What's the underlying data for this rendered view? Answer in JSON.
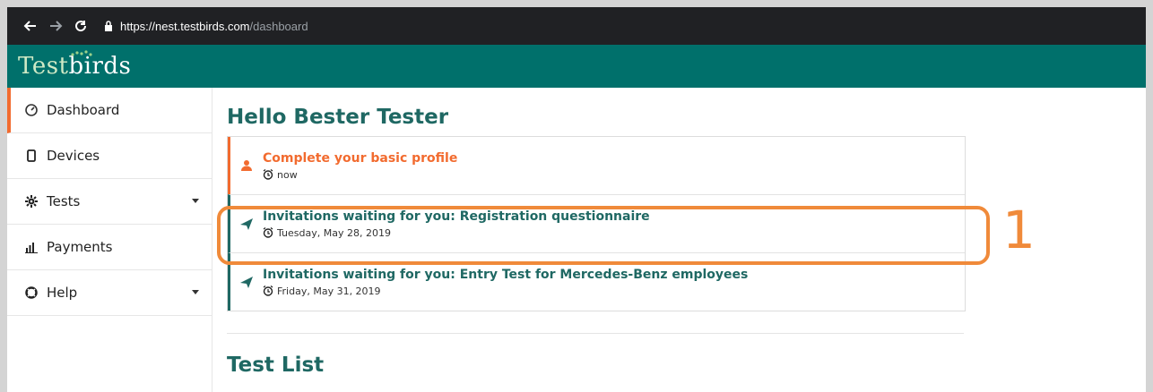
{
  "browser": {
    "url_host": "https://nest.testbirds.com",
    "url_path": "/dashboard"
  },
  "app": {
    "logo_part1": "Test",
    "logo_part2": "birds",
    "brand_color": "#00706b",
    "accent_color": "#f26b2f"
  },
  "sidebar": {
    "items": [
      {
        "label": "Dashboard",
        "icon": "dashboard-icon",
        "active": true
      },
      {
        "label": "Devices",
        "icon": "mobile-icon"
      },
      {
        "label": "Tests",
        "icon": "gear-icon",
        "has_dropdown": true
      },
      {
        "label": "Payments",
        "icon": "bar-chart-icon"
      },
      {
        "label": "Help",
        "icon": "lifebuoy-icon",
        "has_dropdown": true
      }
    ]
  },
  "main": {
    "greeting": "Hello Bester Tester",
    "notifications": [
      {
        "title": "Complete your basic profile",
        "time": "now",
        "icon": "user-icon",
        "color": "orange"
      },
      {
        "title": "Invitations waiting for you: Registration questionnaire",
        "time": "Tuesday, May 28, 2019",
        "icon": "paper-plane-icon",
        "color": "teal"
      },
      {
        "title": "Invitations waiting for you: Entry Test for Mercedes-Benz employees",
        "time": "Friday, May 31, 2019",
        "icon": "paper-plane-icon",
        "color": "teal"
      }
    ],
    "section_title": "Test List"
  },
  "annotation": {
    "number": "1"
  }
}
